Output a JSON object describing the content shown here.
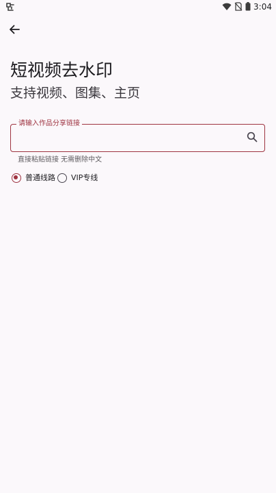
{
  "status_bar": {
    "time": "3:04",
    "left_icon": "notification-app-icon",
    "icons": [
      "wifi-icon",
      "no-sim-icon",
      "battery-icon"
    ]
  },
  "header": {
    "back_icon": "arrow-left-icon"
  },
  "main": {
    "title": "短视频去水印",
    "subtitle": "支持视频、图集、主页"
  },
  "link_input": {
    "label": "请输入作品分享链接",
    "value": "",
    "search_icon": "search-icon",
    "helper": "直接粘贴链接 无需删除中文"
  },
  "route_options": [
    {
      "label": "普通线路",
      "selected": true
    },
    {
      "label": "VIP专线",
      "selected": false
    }
  ],
  "colors": {
    "accent": "#9e3340",
    "background": "#fbf8fb",
    "text": "#1c1b1f"
  }
}
